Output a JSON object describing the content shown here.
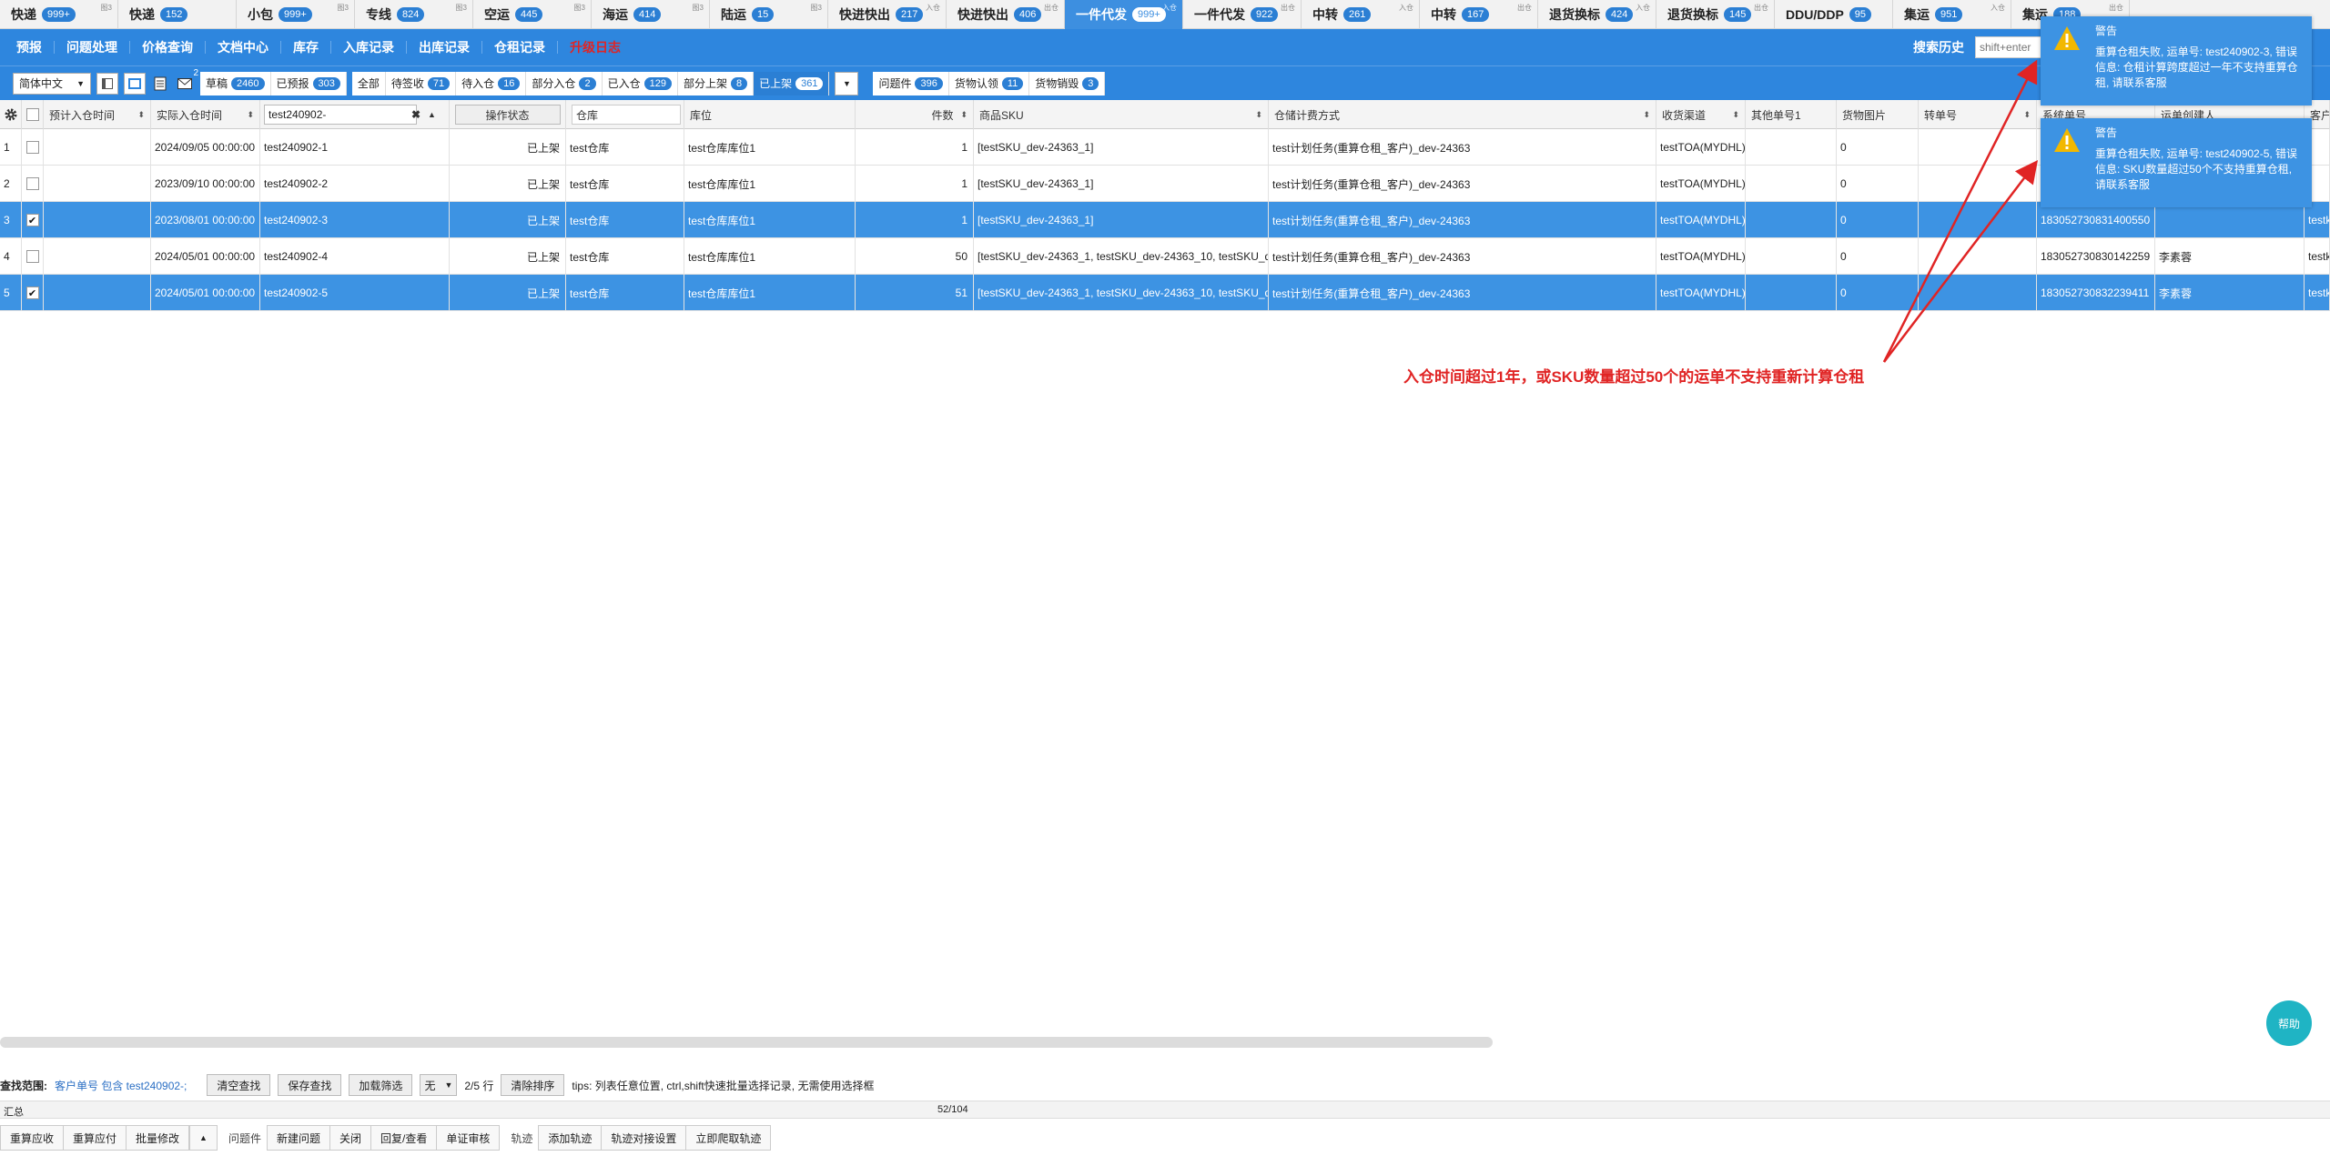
{
  "tabs": [
    {
      "label": "快递",
      "count": "999+",
      "sup": "图3"
    },
    {
      "label": "快递",
      "count": "152",
      "sup": ""
    },
    {
      "label": "小包",
      "count": "999+",
      "sup": "图3"
    },
    {
      "label": "专线",
      "count": "824",
      "sup": "图3"
    },
    {
      "label": "空运",
      "count": "445",
      "sup": "图3"
    },
    {
      "label": "海运",
      "count": "414",
      "sup": "图3"
    },
    {
      "label": "陆运",
      "count": "15",
      "sup": "图3"
    },
    {
      "label": "快进快出",
      "count": "217",
      "sup": "入仓"
    },
    {
      "label": "快进快出",
      "count": "406",
      "sup": "出仓"
    },
    {
      "label": "一件代发",
      "count": "999+",
      "sup": "入仓",
      "active": true
    },
    {
      "label": "一件代发",
      "count": "922",
      "sup": "出仓"
    },
    {
      "label": "中转",
      "count": "261",
      "sup": "入仓"
    },
    {
      "label": "中转",
      "count": "167",
      "sup": "出仓"
    },
    {
      "label": "退货换标",
      "count": "424",
      "sup": "入仓"
    },
    {
      "label": "退货换标",
      "count": "145",
      "sup": "出仓"
    },
    {
      "label": "DDU/DDP",
      "count": "95",
      "sup": ""
    },
    {
      "label": "集运",
      "count": "951",
      "sup": "入仓"
    },
    {
      "label": "集运",
      "count": "188",
      "sup": "出仓"
    }
  ],
  "nav": [
    "预报",
    "问题处理",
    "价格查询",
    "文档中心",
    "库存",
    "入库记录",
    "出库记录",
    "仓租记录"
  ],
  "nav_red": "升级日志",
  "search_history_label": "搜索历史",
  "search_history_placeholder": "shift+enter",
  "lang": "简体中文",
  "mail_count": "2",
  "status_group1": [
    {
      "label": "草稿",
      "count": "2460"
    },
    {
      "label": "已预报",
      "count": "303"
    }
  ],
  "status_group2": [
    {
      "label": "全部",
      "count": ""
    },
    {
      "label": "待签收",
      "count": "71"
    },
    {
      "label": "待入仓",
      "count": "16"
    },
    {
      "label": "部分入仓",
      "count": "2"
    },
    {
      "label": "已入仓",
      "count": "129"
    },
    {
      "label": "部分上架",
      "count": "8"
    },
    {
      "label": "已上架",
      "count": "361",
      "sel": true
    }
  ],
  "status_group3": [
    {
      "label": "问题件",
      "count": "396"
    },
    {
      "label": "货物认领",
      "count": "11"
    },
    {
      "label": "货物销毁",
      "count": "3"
    }
  ],
  "columns": {
    "pre_in": "预计入仓时间",
    "actual_in": "实际入仓时间",
    "customer_no_filter": "test240902-",
    "op_status": "操作状态",
    "warehouse": "仓库",
    "location": "库位",
    "pieces": "件数",
    "sku": "商品SKU",
    "billing": "仓储计费方式",
    "channel": "收货渠道",
    "other_no": "其他单号1",
    "photo": "货物图片",
    "transfer_no": "转单号",
    "system_no": "系统单号",
    "creator": "运单创建人",
    "customer": "客户"
  },
  "rows": [
    {
      "idx": "1",
      "checked": false,
      "actual_in": "2024/09/05 00:00:00",
      "customer_no": "test240902-1",
      "status": "已上架",
      "warehouse": "test仓库",
      "location": "test仓库库位1",
      "pieces": "1",
      "sku": "[testSKU_dev-24363_1]",
      "billing": "test计划任务(重算仓租_客户)_dev-24363",
      "channel": "testTOA(MYDHL)(",
      "photo": "0",
      "system_no": "",
      "creator": "",
      "customer": ""
    },
    {
      "idx": "2",
      "checked": false,
      "actual_in": "2023/09/10 00:00:00",
      "customer_no": "test240902-2",
      "status": "已上架",
      "warehouse": "test仓库",
      "location": "test仓库库位1",
      "pieces": "1",
      "sku": "[testSKU_dev-24363_1]",
      "billing": "test计划任务(重算仓租_客户)_dev-24363",
      "channel": "testTOA(MYDHL)(",
      "photo": "0",
      "system_no": "",
      "creator": "",
      "customer": ""
    },
    {
      "idx": "3",
      "checked": true,
      "actual_in": "2023/08/01 00:00:00",
      "customer_no": "test240902-3",
      "status": "已上架",
      "warehouse": "test仓库",
      "location": "test仓库库位1",
      "pieces": "1",
      "sku": "[testSKU_dev-24363_1]",
      "billing": "test计划任务(重算仓租_客户)_dev-24363",
      "channel": "testTOA(MYDHL)(",
      "photo": "0",
      "system_no": "183052730831400550",
      "creator": "",
      "customer": "testk"
    },
    {
      "idx": "4",
      "checked": false,
      "actual_in": "2024/05/01 00:00:00",
      "customer_no": "test240902-4",
      "status": "已上架",
      "warehouse": "test仓库",
      "location": "test仓库库位1",
      "pieces": "50",
      "sku": "[testSKU_dev-24363_1, testSKU_dev-24363_10, testSKU_d",
      "billing": "test计划任务(重算仓租_客户)_dev-24363",
      "channel": "testTOA(MYDHL)(",
      "photo": "0",
      "system_no": "183052730830142259",
      "creator": "李素蓉",
      "customer": "testk"
    },
    {
      "idx": "5",
      "checked": true,
      "actual_in": "2024/05/01 00:00:00",
      "customer_no": "test240902-5",
      "status": "已上架",
      "warehouse": "test仓库",
      "location": "test仓库库位1",
      "pieces": "51",
      "sku": "[testSKU_dev-24363_1, testSKU_dev-24363_10, testSKU_d",
      "billing": "test计划任务(重算仓租_客户)_dev-24363",
      "channel": "testTOA(MYDHL)(",
      "photo": "0",
      "system_no": "183052730832239411",
      "creator": "李素蓉",
      "customer": "testk"
    }
  ],
  "toasts": [
    {
      "title": "警告",
      "msg": "重算仓租失败, 运单号: test240902-3, 错误信息: 仓租计算跨度超过一年不支持重算仓租, 请联系客服"
    },
    {
      "title": "警告",
      "msg": "重算仓租失败, 运单号: test240902-5, 错误信息: SKU数量超过50个不支持重算仓租, 请联系客服"
    }
  ],
  "annotation": "入仓时间超过1年，或SKU数量超过50个的运单不支持重新计算仓租",
  "search_scope_label": "查找范围:",
  "search_scope_value": "客户单号 包含 test240902-;",
  "btn_clear_search": "清空查找",
  "btn_save_search": "保存查找",
  "btn_load_filter": "加载筛选",
  "filter_select": "无",
  "rows_info": "2/5 行",
  "btn_clear_sort": "清除排序",
  "tips": "tips: 列表任意位置, ctrl,shift快速批量选择记录, 无需使用选择框",
  "summary_label": "汇总",
  "summary_pieces": "52/104",
  "bottom_grp1": [
    "重算应收",
    "重算应付",
    "批量修改"
  ],
  "bottom_lbl_problem": "问题件",
  "bottom_grp2": [
    "新建问题",
    "关闭",
    "回复/查看",
    "单证审核"
  ],
  "bottom_lbl_track": "轨迹",
  "bottom_grp3": [
    "添加轨迹",
    "轨迹对接设置",
    "立即爬取轨迹"
  ],
  "help": "帮助",
  "colors": {
    "primary": "#2e86de",
    "selected_row": "#3d93e3",
    "badge": "#2b7fd4",
    "annotation": "#e02424",
    "help": "#1fb4c4"
  }
}
